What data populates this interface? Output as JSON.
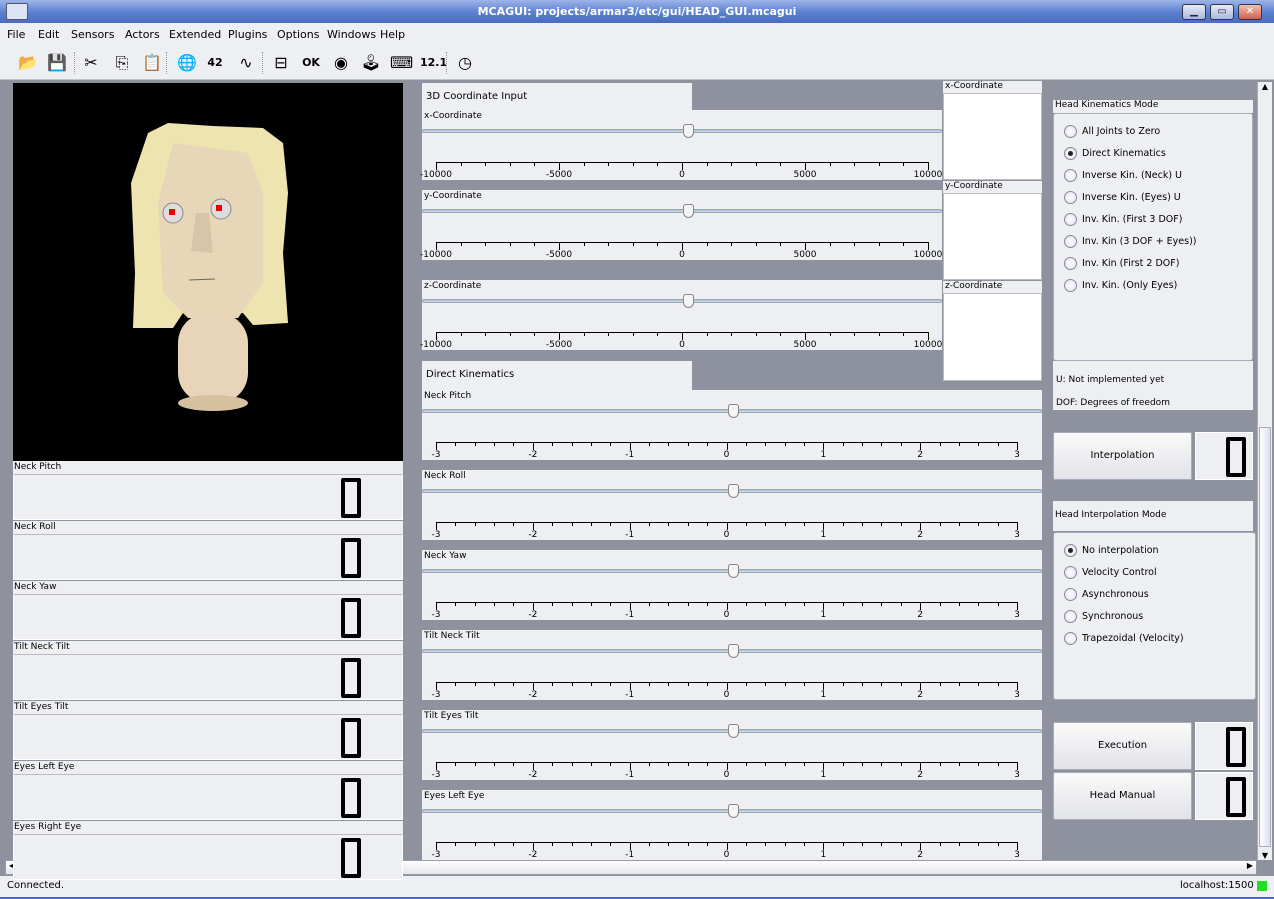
{
  "window": {
    "title": "MCAGUI: projects/armar3/etc/gui/HEAD_GUI.mcagui",
    "buttons": [
      "▁",
      "▭",
      "✕"
    ]
  },
  "menu": [
    "File",
    "Edit",
    "Sensors",
    "Actors",
    "Extended",
    "Plugins",
    "Options",
    "Windows",
    "Help"
  ],
  "toolbar": [
    {
      "icon": "open-folder-icon",
      "glyph": "📂"
    },
    {
      "icon": "save-icon",
      "glyph": "💾"
    },
    {
      "icon": "cut-icon",
      "glyph": "✂"
    },
    {
      "icon": "copy-icon",
      "glyph": "⎘"
    },
    {
      "icon": "paste-icon",
      "glyph": "📋"
    },
    {
      "icon": "globe-icon",
      "glyph": "🌐"
    },
    {
      "icon": "number-display-icon",
      "glyph": "42"
    },
    {
      "icon": "oscilloscope-icon",
      "glyph": "∿"
    },
    {
      "icon": "slider-icon",
      "glyph": "⊟"
    },
    {
      "icon": "ok-button-icon",
      "glyph": "OK"
    },
    {
      "icon": "radio-options-icon",
      "glyph": "◉"
    },
    {
      "icon": "joystick-icon",
      "glyph": "🕹"
    },
    {
      "icon": "keyboard-icon",
      "glyph": "⌨"
    },
    {
      "icon": "value-display-icon",
      "glyph": "12.1"
    },
    {
      "icon": "clock-icon",
      "glyph": "◷"
    }
  ],
  "joint_displays": [
    {
      "label": "Neck Pitch",
      "value": 0
    },
    {
      "label": "Neck Roll",
      "value": 0
    },
    {
      "label": "Neck Yaw",
      "value": 0
    },
    {
      "label": "Tilt Neck Tilt",
      "value": 0
    },
    {
      "label": "Tilt Eyes Tilt",
      "value": 0
    },
    {
      "label": "Eyes Left Eye",
      "value": 0
    },
    {
      "label": "Eyes Right Eye",
      "value": 0
    }
  ],
  "coord": {
    "header": "3D Coordinate Input",
    "min": -10000,
    "max": 10000,
    "ticks": [
      -10000,
      -5000,
      0,
      5000,
      10000
    ],
    "sliders": [
      {
        "label": "x-Coordinate",
        "value": 0
      },
      {
        "label": "y-Coordinate",
        "value": 0
      },
      {
        "label": "z-Coordinate",
        "value": 0
      }
    ],
    "boxes": [
      "x-Coordinate",
      "y-Coordinate",
      "z-Coordinate"
    ]
  },
  "dk": {
    "header": "Direct Kinematics",
    "min": -3,
    "max": 3,
    "ticks": [
      -3,
      -2,
      -1,
      0,
      1,
      2,
      3
    ],
    "sliders": [
      {
        "label": "Neck Pitch",
        "value": 0
      },
      {
        "label": "Neck Roll",
        "value": 0
      },
      {
        "label": "Neck Yaw",
        "value": 0
      },
      {
        "label": "Tilt Neck Tilt",
        "value": 0
      },
      {
        "label": "Tilt Eyes Tilt",
        "value": 0
      },
      {
        "label": "Eyes Left Eye",
        "value": 0
      }
    ]
  },
  "kin_mode": {
    "title": "Head Kinematics Mode",
    "selected": 1,
    "options": [
      "All Joints to Zero",
      "Direct Kinematics",
      "Inverse Kin. (Neck) U",
      "Inverse Kin. (Eyes) U",
      "Inv. Kin. (First 3 DOF)",
      "Inv. Kin (3 DOF + Eyes))",
      "Inv. Kin (First 2 DOF)",
      "Inv. Kin. (Only Eyes)"
    ],
    "note_u": "U: Not implemented yet",
    "note_dof": "DOF: Degrees of freedom"
  },
  "interp_mode": {
    "title": "Head Interpolation Mode",
    "selected": 0,
    "options": [
      "No interpolation",
      "Velocity Control",
      "Asynchronous",
      "Synchronous",
      "Trapezoidal (Velocity)"
    ]
  },
  "buttons": {
    "interpolation": "Interpolation",
    "execution": "Execution",
    "head_manual": "Head Manual"
  },
  "status": {
    "text": "Connected.",
    "host": "localhost:1500",
    "indicator_color": "#22dd22"
  }
}
